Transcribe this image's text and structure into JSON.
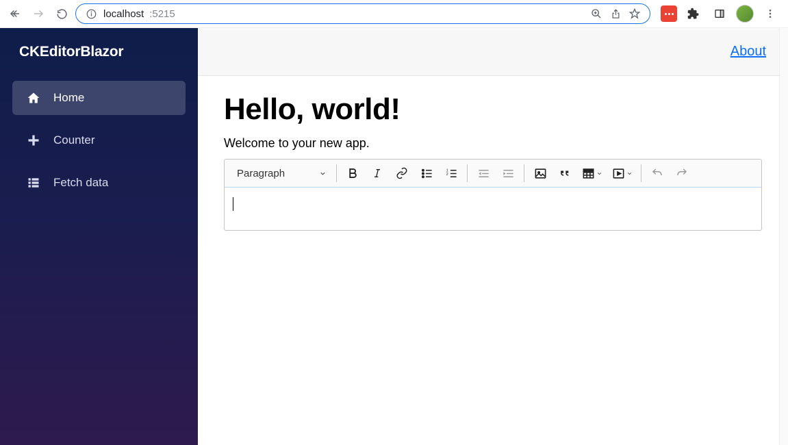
{
  "chrome": {
    "url_host": "localhost",
    "url_port": ":5215"
  },
  "sidebar": {
    "app_title": "CKEditorBlazor",
    "items": [
      {
        "label": "Home"
      },
      {
        "label": "Counter"
      },
      {
        "label": "Fetch data"
      }
    ]
  },
  "topbar": {
    "about_label": "About"
  },
  "page": {
    "heading": "Hello, world!",
    "welcome": "Welcome to your new app."
  },
  "editor": {
    "heading_dropdown": "Paragraph",
    "content": ""
  }
}
